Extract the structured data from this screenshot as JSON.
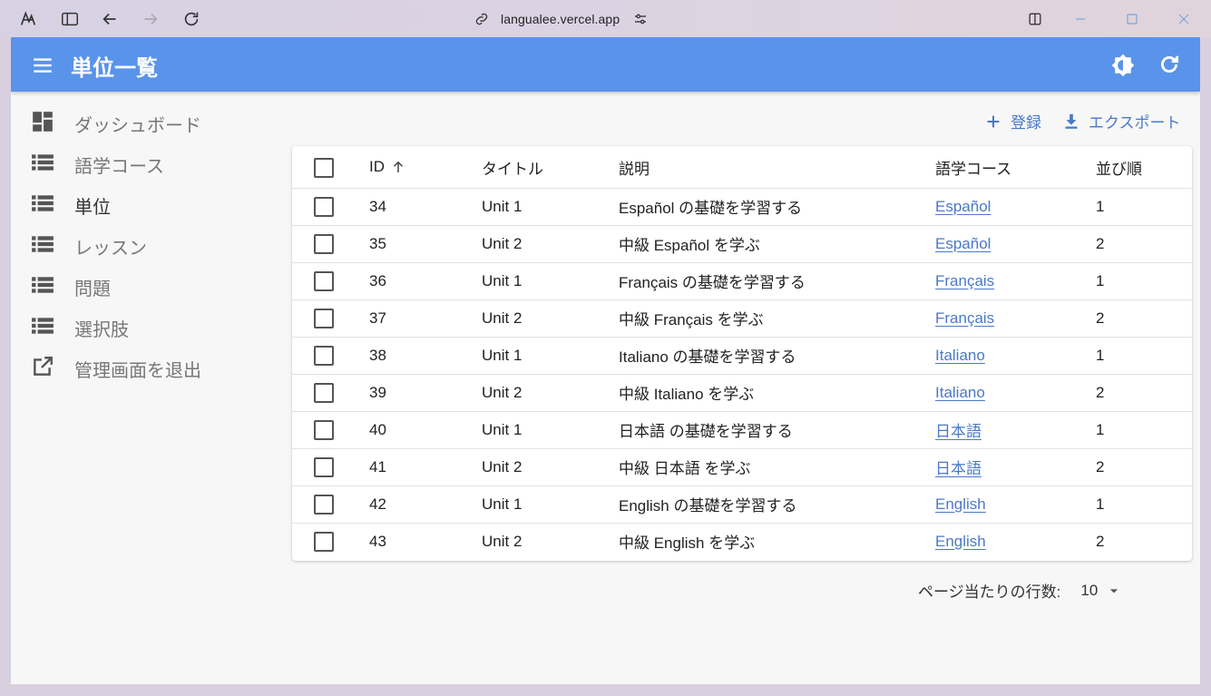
{
  "browser": {
    "url": "langualee.vercel.app"
  },
  "appbar": {
    "title": "単位一覧"
  },
  "sidebar": {
    "items": [
      {
        "label": "ダッシュボード",
        "icon": "dashboard-icon",
        "active": false
      },
      {
        "label": "語学コース",
        "icon": "list-icon",
        "active": false
      },
      {
        "label": "単位",
        "icon": "list-icon",
        "active": true
      },
      {
        "label": "レッスン",
        "icon": "list-icon",
        "active": false
      },
      {
        "label": "問題",
        "icon": "list-icon",
        "active": false
      },
      {
        "label": "選択肢",
        "icon": "list-icon",
        "active": false
      },
      {
        "label": "管理画面を退出",
        "icon": "external-link-icon",
        "active": false
      }
    ]
  },
  "toolbar": {
    "create_label": "登録",
    "export_label": "エクスポート"
  },
  "table": {
    "columns": [
      "ID",
      "タイトル",
      "説明",
      "語学コース",
      "並び順"
    ],
    "rows": [
      {
        "id": "34",
        "title": "Unit 1",
        "description": "Español の基礎を学習する",
        "course": "Español",
        "order": "1"
      },
      {
        "id": "35",
        "title": "Unit 2",
        "description": "中級 Español を学ぶ",
        "course": "Español",
        "order": "2"
      },
      {
        "id": "36",
        "title": "Unit 1",
        "description": "Français の基礎を学習する",
        "course": "Français",
        "order": "1"
      },
      {
        "id": "37",
        "title": "Unit 2",
        "description": "中級 Français を学ぶ",
        "course": "Français",
        "order": "2"
      },
      {
        "id": "38",
        "title": "Unit 1",
        "description": "Italiano の基礎を学習する",
        "course": "Italiano",
        "order": "1"
      },
      {
        "id": "39",
        "title": "Unit 2",
        "description": "中級 Italiano を学ぶ",
        "course": "Italiano",
        "order": "2"
      },
      {
        "id": "40",
        "title": "Unit 1",
        "description": "日本語 の基礎を学習する",
        "course": "日本語",
        "order": "1"
      },
      {
        "id": "41",
        "title": "Unit 2",
        "description": "中級 日本語 を学ぶ",
        "course": "日本語",
        "order": "2"
      },
      {
        "id": "42",
        "title": "Unit 1",
        "description": "English の基礎を学習する",
        "course": "English",
        "order": "1"
      },
      {
        "id": "43",
        "title": "Unit 2",
        "description": "中級 English を学ぶ",
        "course": "English",
        "order": "2"
      }
    ]
  },
  "pagination": {
    "rows_per_page_label": "ページ当たりの行数:",
    "rows_per_page_value": "10"
  },
  "colors": {
    "appbar": "#5a93ea",
    "link": "#4a79c9"
  }
}
